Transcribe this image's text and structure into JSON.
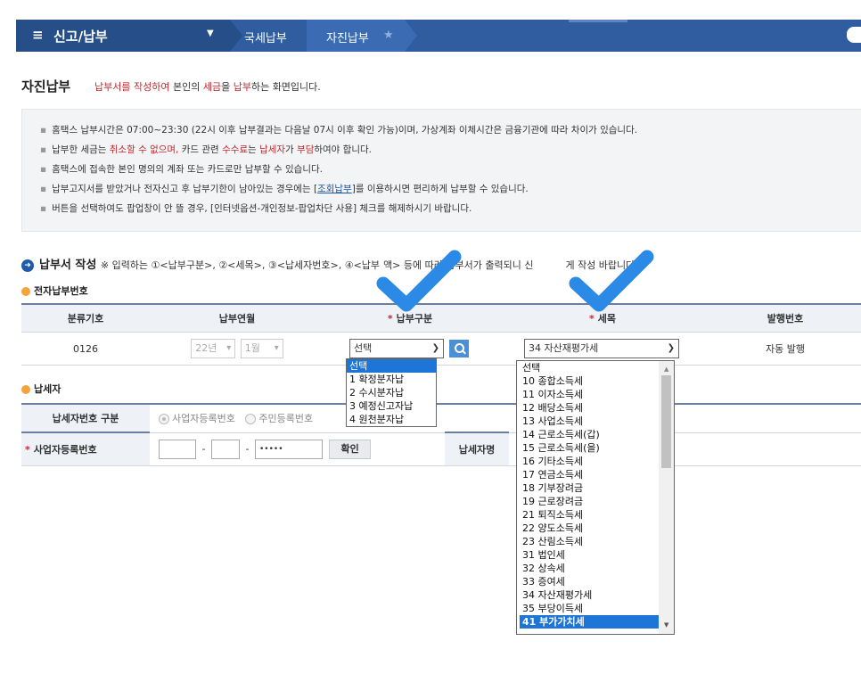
{
  "topbar": {
    "menu_title": "신고/납부",
    "crumb1": "국세납부",
    "crumb2": "자진납부"
  },
  "page": {
    "title": "자진납부",
    "desc_red1": "납부서를 작성하여",
    "desc_mid1": " 본인의 ",
    "desc_red2": "세금",
    "desc_mid2": "을 ",
    "desc_red3": "납부",
    "desc_end": "하는 화면입니다."
  },
  "notice": {
    "line1": "홈택스 납부시간은 07:00~23:30 (22시 이후 납부결과는 다음날 07시 이후 확인 가능)이며, 가상계좌 이체시간은 금융기관에 따라 차이가 있습니다.",
    "line2_a": "납부한 세금는 ",
    "line2_b": "취소할 수 없으며,",
    "line2_c": " 카드 관련 ",
    "line2_d": "수수료",
    "line2_e": "는 ",
    "line2_f": "납세자",
    "line2_g": "가 ",
    "line2_h": "부담",
    "line2_i": "하여야 합니다.",
    "line3": "홈택스에 접속한 본인 명의의 계좌 또는 카드로만 납부할 수 있습니다.",
    "line4_a": "납부고지서를 받았거나 전자신고 후 납부기한이 남아있는 경우에는 [",
    "line4_link": "조회납부",
    "line4_b": "]를 이용하시면 편리하게  납부할 수 있습니다.",
    "line5": "버튼을 선택하여도 팝업창이 안 뜰 경우, [인터넷옵션-개인정보-팝업차단 사용] 체크를 해제하시기 바랍니다."
  },
  "section": {
    "title": "납부서 작성",
    "note": "※ 입력하는 ①<납부구분>, ②<세목>, ③<납세자번호>, ④<납부",
    "note_tail": "액> 등에 따라 납부서가 출력되니 신",
    "note_end": "게 작성 바랍니다."
  },
  "sub1": {
    "title": "전자납부번호"
  },
  "table": {
    "headers": [
      "분류기호",
      "납부연월",
      "납부구분",
      "세목",
      "발행번호"
    ],
    "code": "0126",
    "year": "22년",
    "month": "1월",
    "pay_type_selected": "선택",
    "tax_selected": "34 자산재평가세",
    "issue_no": "자동 발행"
  },
  "pay_type_options": [
    "선택",
    "1 확정분자납",
    "2 수시분자납",
    "3 예정신고자납",
    "4 원천분자납"
  ],
  "tax_options": [
    "선택",
    "10 종합소득세",
    "11 이자소득세",
    "12 배당소득세",
    "13 사업소득세",
    "14 근로소득세(갑)",
    "15 근로소득세(을)",
    "16 기타소득세",
    "17 연금소득세",
    "18 기부장려금",
    "19 근로장려금",
    "21 퇴직소득세",
    "22 양도소득세",
    "23 산림소득세",
    "31 법인세",
    "32 상속세",
    "33 증여세",
    "34 자산재평가세",
    "35 부당이득세",
    "41 부가가치세"
  ],
  "sub2": {
    "title": "납세자"
  },
  "taxpayer": {
    "row1_label": "납세자번호 구분",
    "radio1": "사업자등록번호",
    "radio2": "주민등록번호",
    "row2_label": "사업자등록번호",
    "password_mask": "•••••",
    "confirm_btn": "확인",
    "name_label": "납세자명"
  },
  "colors": {
    "header_blue": "#2f5d9f",
    "accent_red": "#c0282d",
    "check_blue": "#2a8ae6",
    "select_blue": "#1e75d8"
  }
}
